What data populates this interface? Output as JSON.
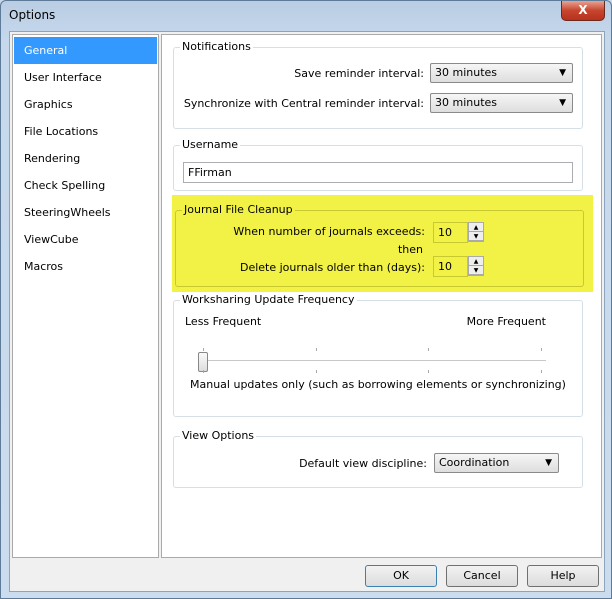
{
  "window": {
    "title": "Options",
    "close": "X"
  },
  "sidebar": {
    "items": [
      {
        "label": "General",
        "selected": true
      },
      {
        "label": "User Interface"
      },
      {
        "label": "Graphics"
      },
      {
        "label": "File Locations"
      },
      {
        "label": "Rendering"
      },
      {
        "label": "Check Spelling"
      },
      {
        "label": "SteeringWheels"
      },
      {
        "label": "ViewCube"
      },
      {
        "label": "Macros"
      }
    ]
  },
  "notifications": {
    "title": "Notifications",
    "save_label": "Save reminder interval:",
    "save_value": "30 minutes",
    "sync_label": "Synchronize with Central reminder interval:",
    "sync_value": "30 minutes"
  },
  "username": {
    "title": "Username",
    "value": "FFirman"
  },
  "journal": {
    "title": "Journal File Cleanup",
    "exceeds_label": "When number of journals exceeds:",
    "exceeds_value": "10",
    "then": "then",
    "delete_label": "Delete journals older than (days):",
    "delete_value": "10",
    "highlight_color": "#f2f246"
  },
  "worksharing": {
    "title": "Worksharing Update Frequency",
    "less": "Less Frequent",
    "more": "More Frequent",
    "slider_position": 0,
    "slider_steps": 3,
    "description": "Manual updates only (such as borrowing elements or synchronizing)"
  },
  "view": {
    "title": "View Options",
    "discipline_label": "Default view discipline:",
    "discipline_value": "Coordination"
  },
  "buttons": {
    "ok": "OK",
    "cancel": "Cancel",
    "help": "Help"
  }
}
